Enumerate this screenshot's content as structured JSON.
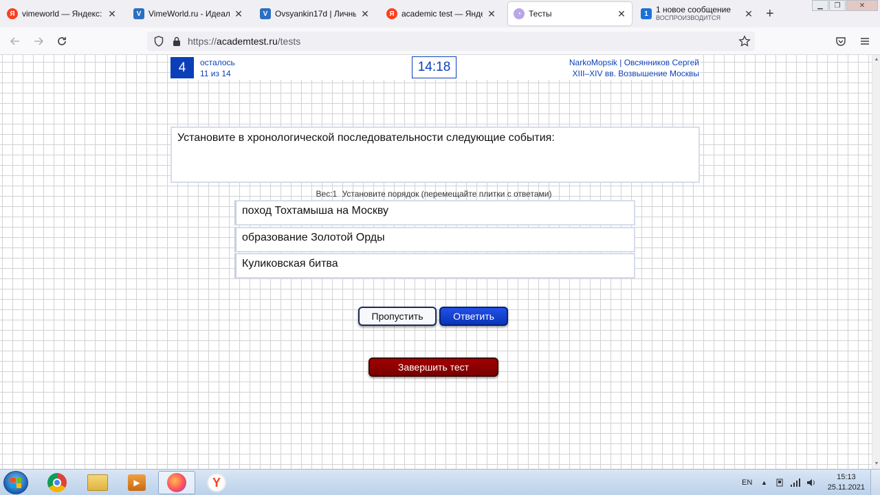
{
  "tabs": [
    {
      "title": "vimeworld — Яндекс: нашлось",
      "favicon": "yandex-icon"
    },
    {
      "title": "VimeWorld.ru - Идеальный",
      "favicon": "vimeworld-icon"
    },
    {
      "title": "Ovsyankin17d | Личный к",
      "favicon": "vimeworld-icon"
    },
    {
      "title": "academic test — Яндекс: н",
      "favicon": "yandex-icon"
    },
    {
      "title": "Тесты",
      "favicon": "chat-icon",
      "active": true
    },
    {
      "title": "1 новое сообщение",
      "subtitle": "ВОСПРОИЗВОДИТСЯ",
      "badge": "1",
      "favicon": "message-icon"
    }
  ],
  "address": {
    "prefix": "https://",
    "host": "academtest.ru",
    "path": "/tests"
  },
  "test": {
    "remaining_count": "4",
    "remaining_label": "осталось",
    "progress": "11 из 14",
    "timer": "14:18",
    "user_nick": "NarkoMopsik",
    "user_sep": " | ",
    "user_name": "Овсянников Сергей",
    "topic": "XIII–XIV вв. Возвышение Москвы",
    "question": "Установите в хронологической последовательности следующие события:",
    "weight": "Вес:1",
    "instruction": "Установите порядок (перемещайте плитки с ответами)",
    "tiles": [
      "поход Тохтамыша на Москву",
      "образование Золотой Орды",
      "Куликовская битва"
    ],
    "skip_label": "Пропустить",
    "answer_label": "Ответить",
    "finish_label": "Завершить тест"
  },
  "taskbar": {
    "lang": "EN",
    "time": "15:13",
    "date": "25.11.2021"
  },
  "colors": {
    "accent": "#0a3fb8",
    "finish": "#8b0000"
  }
}
